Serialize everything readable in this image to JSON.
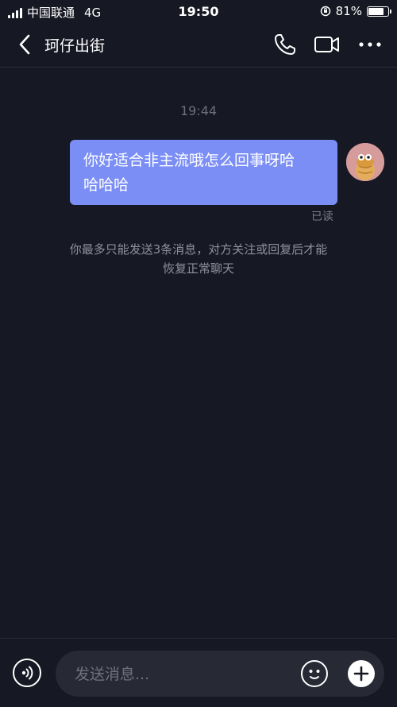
{
  "status_bar": {
    "carrier": "中国联通",
    "network": "4G",
    "time": "19:50",
    "battery_percent": "81%",
    "battery_level": 0.81
  },
  "nav": {
    "title": "珂仔出街",
    "icons": [
      "back-arrow-icon",
      "phone-icon",
      "video-icon",
      "more-icon"
    ]
  },
  "chat": {
    "timestamp": "19:44",
    "message_line1": "你好适合非主流哦怎么回事呀哈",
    "message_line2": "哈哈哈",
    "read_status": "已读",
    "notice_line1": "你最多只能发送3条消息，对方关注或回复后才能",
    "notice_line2": "恢复正常聊天"
  },
  "input": {
    "placeholder": "发送消息..."
  },
  "colors": {
    "background": "#161823",
    "bubble": "#7b8ef5",
    "input_bg": "#272935"
  }
}
